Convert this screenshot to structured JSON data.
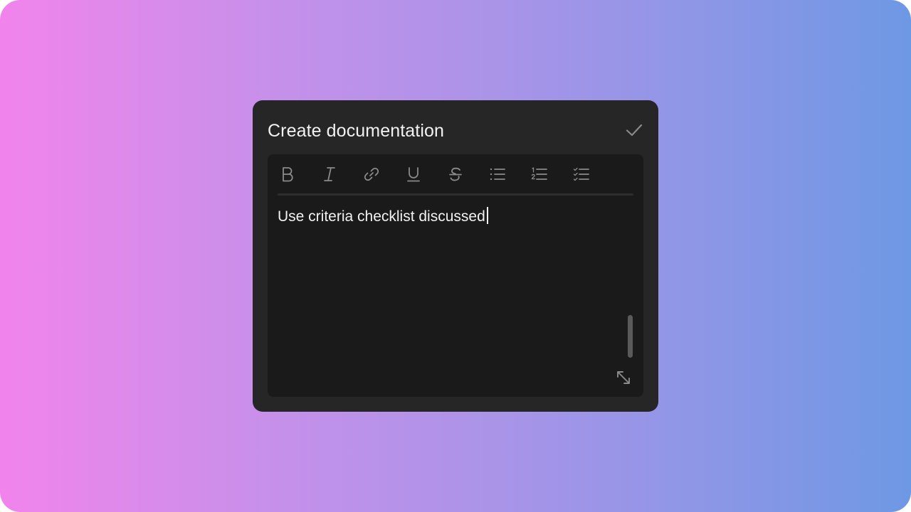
{
  "dialog": {
    "title": "Create documentation",
    "confirm_icon": "check-icon"
  },
  "toolbar": {
    "tools": [
      {
        "name": "bold",
        "icon": "bold-icon"
      },
      {
        "name": "italic",
        "icon": "italic-icon"
      },
      {
        "name": "link",
        "icon": "link-icon"
      },
      {
        "name": "underline",
        "icon": "underline-icon"
      },
      {
        "name": "strikethrough",
        "icon": "strikethrough-icon"
      },
      {
        "name": "bulleted-list",
        "icon": "bullet-list-icon"
      },
      {
        "name": "numbered-list",
        "icon": "numbered-list-icon"
      },
      {
        "name": "checklist",
        "icon": "checklist-icon"
      }
    ]
  },
  "editor": {
    "content": "Use criteria checklist discussed",
    "resize_icon": "resize-icon"
  },
  "colors": {
    "background_gradient_start": "#f184ec",
    "background_gradient_end": "#6e98e4",
    "card": "#262626",
    "editor": "#1a1a1a",
    "icon": "#8a8a8a",
    "text": "#f2f2f2"
  }
}
